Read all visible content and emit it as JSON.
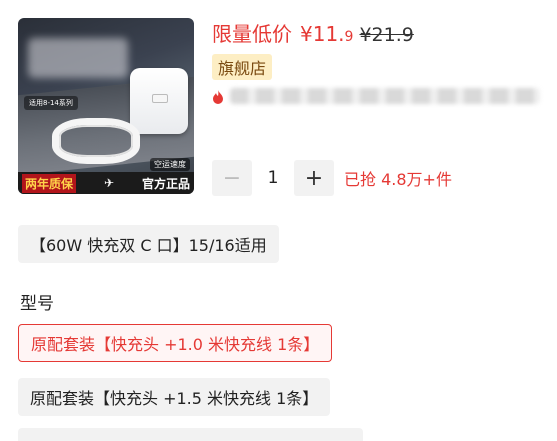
{
  "product": {
    "image": {
      "spec_tag": "适用8-14系列",
      "shipping_tag": "空运速度",
      "banner_left": "两年质保",
      "banner_right": "官方正品"
    },
    "price_label": "限量低价",
    "price_symbol": "¥",
    "price_int": "11.",
    "price_dec": "9",
    "price_old": "¥21.9",
    "badge": "旗舰店"
  },
  "quantity": {
    "minus": "−",
    "value": "1",
    "plus": "+",
    "sold_text": "已抢 4.8万+件"
  },
  "compat_chip": "【60W 快充双 C 口】15/16适用",
  "section_title": "型号",
  "options": [
    {
      "label": "原配套装【快充头 +1.0 米快充线 1条】",
      "selected": true
    },
    {
      "label": "原配套装【快充头 +1.5 米快充线 1条】",
      "selected": false
    }
  ],
  "colors": {
    "accent": "#e53935",
    "badge_bg": "#fdeec4"
  }
}
